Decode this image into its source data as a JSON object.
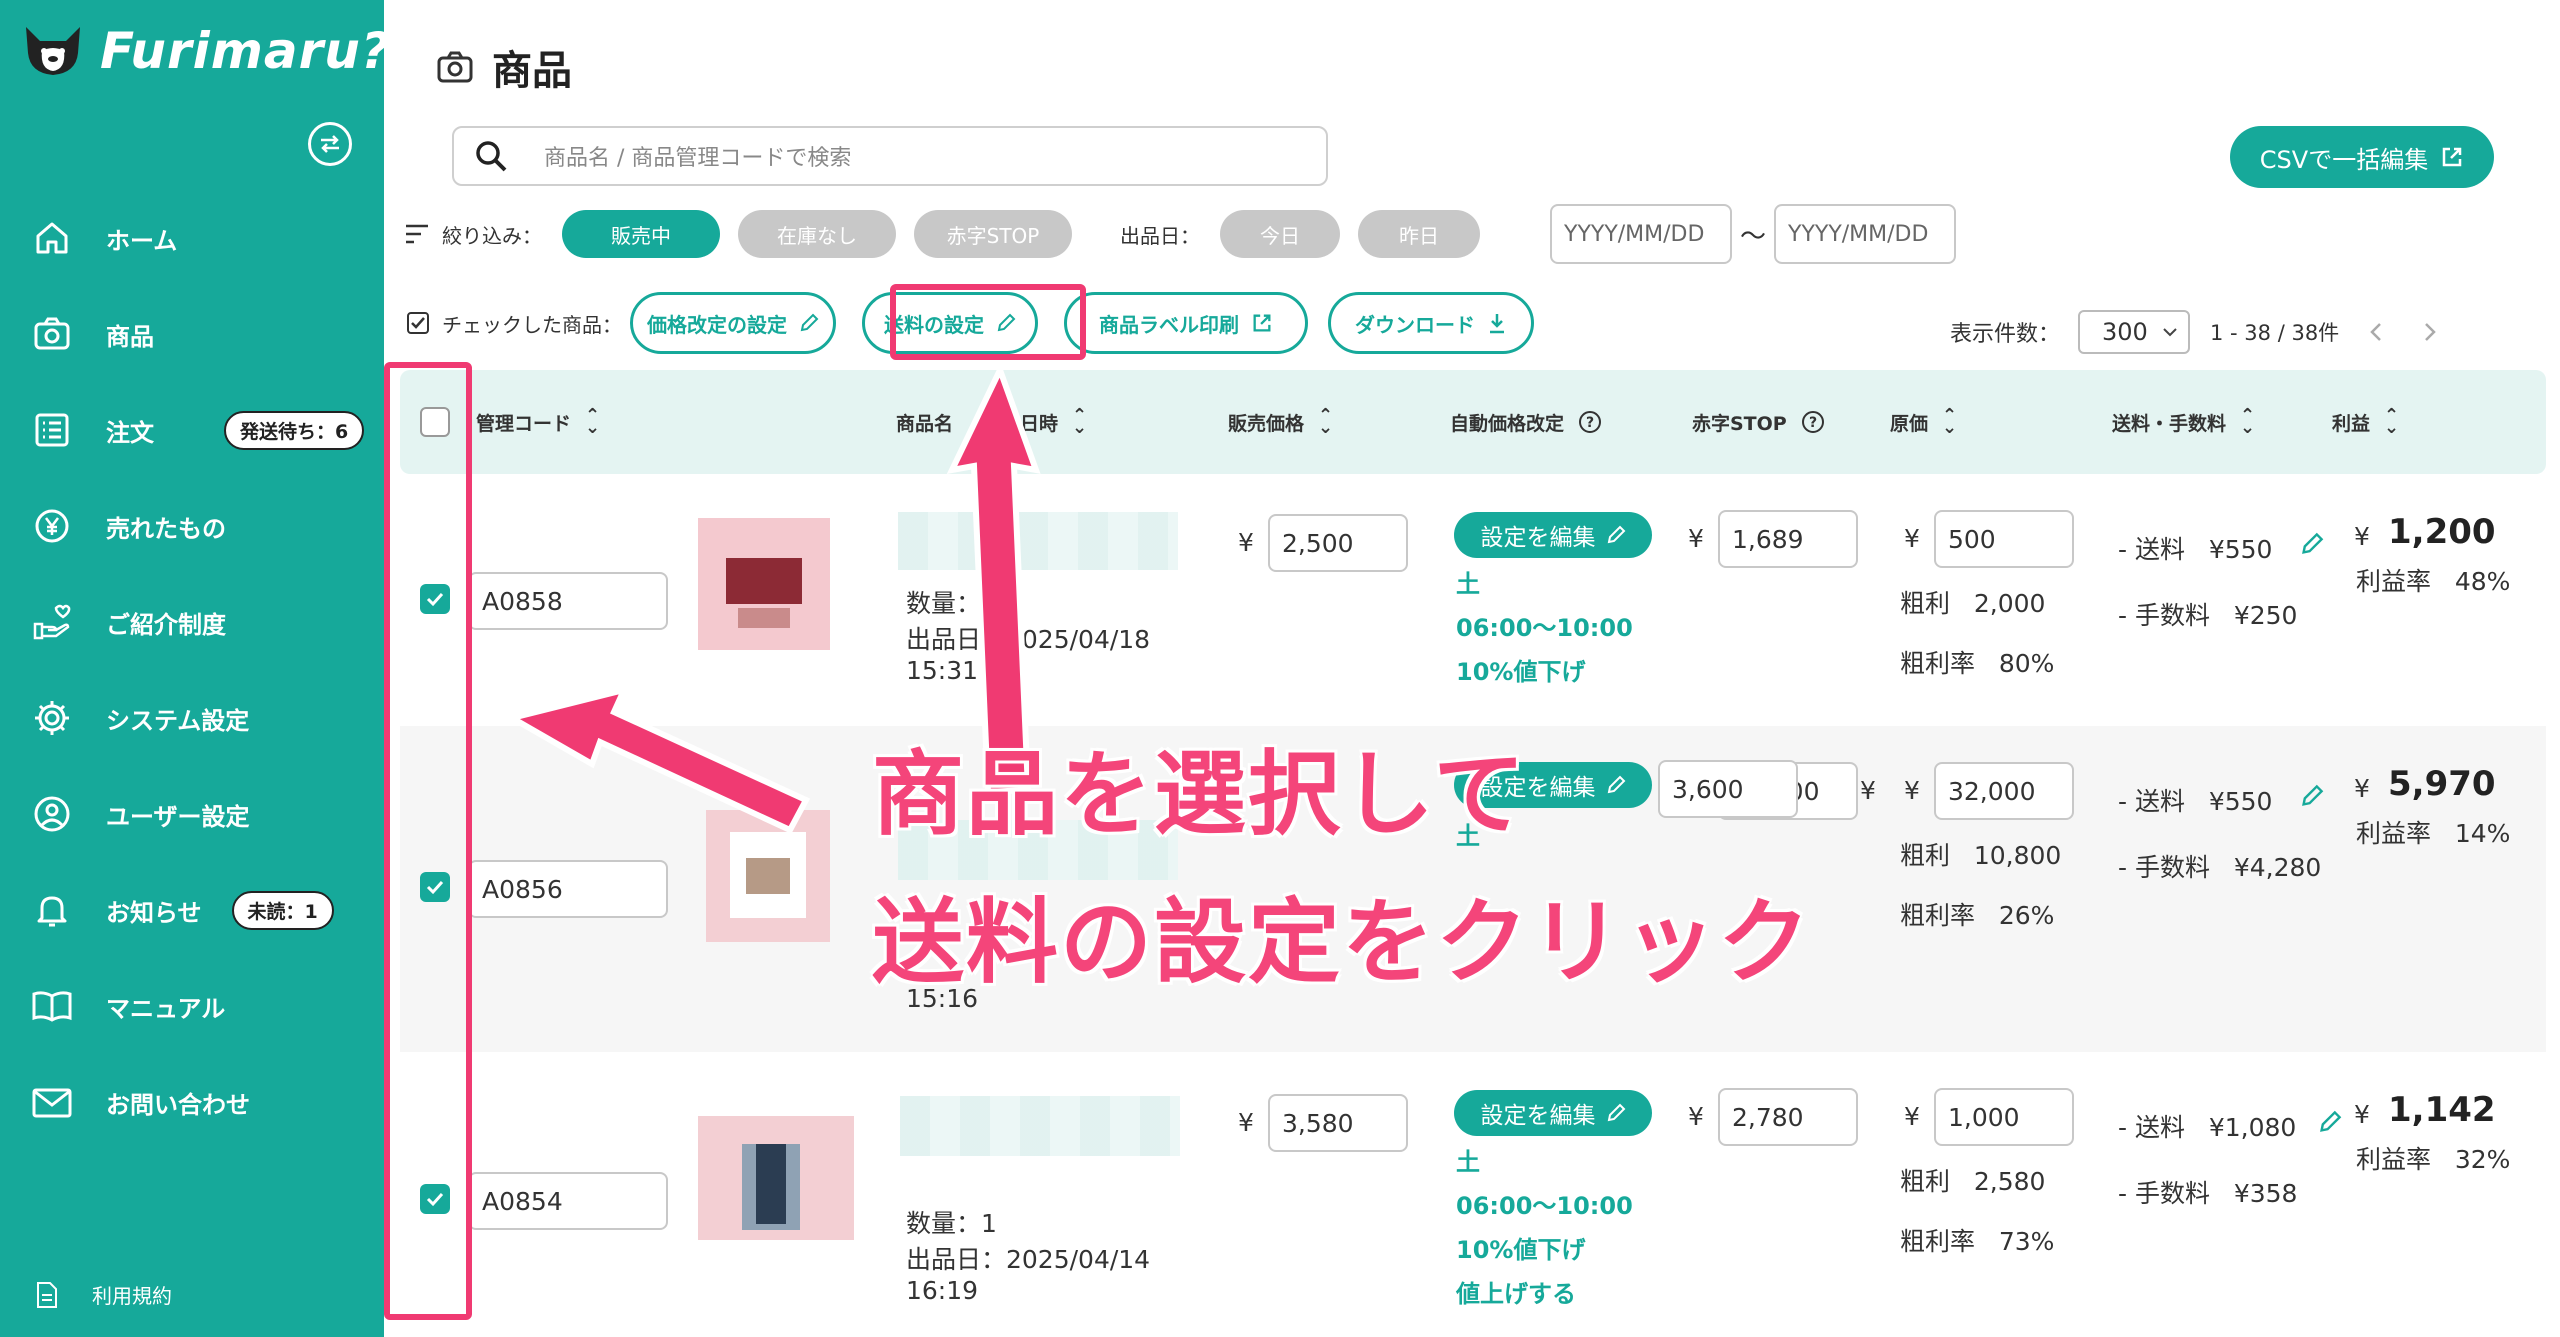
{
  "app": {
    "logo_text": "Furimaru?"
  },
  "sidebar": {
    "items": [
      {
        "label": "ホーム",
        "icon": "home-icon"
      },
      {
        "label": "商品",
        "icon": "camera-icon"
      },
      {
        "label": "注文",
        "icon": "list-icon",
        "badge": "発送待ち：6"
      },
      {
        "label": "売れたもの",
        "icon": "yen-icon"
      },
      {
        "label": "ご紹介制度",
        "icon": "hand-heart-icon"
      },
      {
        "label": "システム設定",
        "icon": "gear-icon"
      },
      {
        "label": "ユーザー設定",
        "icon": "user-icon"
      },
      {
        "label": "お知らせ",
        "icon": "bell-icon",
        "badge": "未読：1"
      },
      {
        "label": "マニュアル",
        "icon": "book-icon"
      },
      {
        "label": "お問い合わせ",
        "icon": "mail-icon"
      }
    ],
    "terms_label": "利用規約"
  },
  "header": {
    "title": "商品"
  },
  "search": {
    "placeholder": "商品名 / 商品管理コードで検索"
  },
  "csv_button": "CSVで一括編集",
  "filters": {
    "label": "絞り込み：",
    "chips": [
      "販売中",
      "在庫なし",
      "赤字STOP"
    ],
    "date_label": "出品日：",
    "date_chips": [
      "今日",
      "昨日"
    ],
    "date_placeholder": "YYYY/MM/DD",
    "tilde": "〜"
  },
  "bulk": {
    "label": "チェックした商品：",
    "buttons": [
      "価格改定の設定",
      "送料の設定",
      "商品ラベル印刷",
      "ダウンロード"
    ]
  },
  "pagination": {
    "per_page_label": "表示件数：",
    "per_page": "300",
    "range": "1 - 38 / 38件"
  },
  "table": {
    "headers": {
      "code": "管理コード",
      "name": "商品名",
      "listed": "出品日時",
      "price": "販売価格",
      "auto": "自動価格改定",
      "stop": "赤字STOP",
      "cost": "原価",
      "ship": "送料・手数料",
      "profit": "利益"
    },
    "labels": {
      "yen": "¥",
      "qty": "数量：1",
      "listed_prefix": "出品日：",
      "gross": "粗利",
      "gross_rate": "粗利率",
      "ship": "- 送料",
      "fee": "- 手数料",
      "profit_rate": "利益率",
      "edit": "設定を編集",
      "day": "土",
      "time": "06:00〜10:00",
      "discount": "10%値下げ",
      "raise": "値上げする"
    },
    "rows": [
      {
        "code": "A0858",
        "qty_line": "数量：1",
        "date": "出品日：2025/04/18",
        "time": "15:31",
        "price": "2,500",
        "stop": "1,689",
        "cost": "500",
        "gross": "2,000",
        "gross_rate": "80%",
        "ship": "¥550",
        "fee": "¥250",
        "profit": "1,200",
        "profit_rate": "48%"
      },
      {
        "code": "A0856",
        "time_only": "15:16",
        "price": "3,600",
        "stop": "37,200",
        "cost": "32,000",
        "gross": "10,800",
        "gross_rate": "26%",
        "ship": "¥550",
        "fee": "¥4,280",
        "profit": "5,970",
        "profit_rate": "14%"
      },
      {
        "code": "A0854",
        "qty_line": "数量：1",
        "date": "出品日：2025/04/14",
        "time": "16:19",
        "price": "3,580",
        "stop": "2,780",
        "cost": "1,000",
        "gross": "2,580",
        "gross_rate": "73%",
        "ship": "¥1,080",
        "fee": "¥358",
        "profit": "1,142",
        "profit_rate": "32%"
      }
    ]
  },
  "annotation": {
    "line1": "商品を選択して",
    "line2": "送料の設定をクリック",
    "color": "#f03a72"
  },
  "colors": {
    "brand": "#16a99a",
    "accent": "#f03a72"
  }
}
